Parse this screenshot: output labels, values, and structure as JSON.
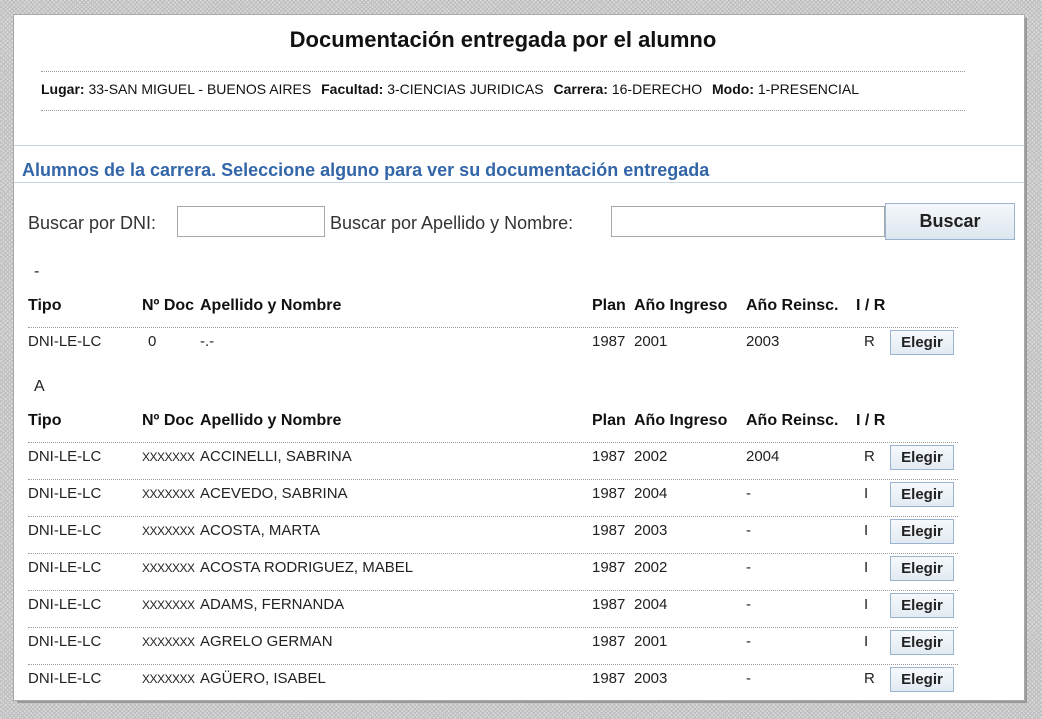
{
  "page": {
    "title": "Documentación entregada por el alumno"
  },
  "info": {
    "lugar_label": "Lugar:",
    "lugar": "33-SAN MIGUEL - BUENOS AIRES",
    "facultad_label": "Facultad:",
    "facultad": "3-CIENCIAS JURIDICAS",
    "carrera_label": "Carrera:",
    "carrera": "16-DERECHO",
    "modo_label": "Modo:",
    "modo": "1-PRESENCIAL"
  },
  "section": {
    "title": "Alumnos de la carrera. Seleccione alguno para ver su documentación entregada"
  },
  "search": {
    "dni_label": "Buscar por DNI:",
    "dni_value": "",
    "name_label": "Buscar por Apellido y Nombre:",
    "name_value": "",
    "button_label": "Buscar"
  },
  "table_header": {
    "tipo": "Tipo",
    "doc": "Nº Doc",
    "nombre": "Apellido y Nombre",
    "plan": "Plan",
    "anio_ingreso": "Año Ingreso",
    "anio_reinsc": "Año Reinsc.",
    "ir": "I / R"
  },
  "groups": [
    {
      "letter": "-",
      "rows": [
        {
          "tipo": "DNI-LE-LC",
          "doc": "0",
          "nombre": "-.-",
          "plan": "1987",
          "ingreso": "2001",
          "reinsc": "2003",
          "ir": "R",
          "action": "Elegir"
        }
      ]
    },
    {
      "letter": "A",
      "rows": [
        {
          "tipo": "DNI-LE-LC",
          "doc": "XXXXXXX",
          "nombre": "ACCINELLI, SABRINA",
          "plan": "1987",
          "ingreso": "2002",
          "reinsc": "2004",
          "ir": "R",
          "action": "Elegir"
        },
        {
          "tipo": "DNI-LE-LC",
          "doc": "XXXXXXX",
          "nombre": "ACEVEDO, SABRINA",
          "plan": "1987",
          "ingreso": "2004",
          "reinsc": "-",
          "ir": "I",
          "action": "Elegir"
        },
        {
          "tipo": "DNI-LE-LC",
          "doc": "XXXXXXX",
          "nombre": "ACOSTA, MARTA",
          "plan": "1987",
          "ingreso": "2003",
          "reinsc": "-",
          "ir": "I",
          "action": "Elegir"
        },
        {
          "tipo": "DNI-LE-LC",
          "doc": "XXXXXXX",
          "nombre": "ACOSTA RODRIGUEZ, MABEL",
          "plan": "1987",
          "ingreso": "2002",
          "reinsc": "-",
          "ir": "I",
          "action": "Elegir"
        },
        {
          "tipo": "DNI-LE-LC",
          "doc": "XXXXXXX",
          "nombre": "ADAMS, FERNANDA",
          "plan": "1987",
          "ingreso": "2004",
          "reinsc": "-",
          "ir": "I",
          "action": "Elegir"
        },
        {
          "tipo": "DNI-LE-LC",
          "doc": "XXXXXXX",
          "nombre": "AGRELO GERMAN",
          "plan": "1987",
          "ingreso": "2001",
          "reinsc": "-",
          "ir": "I",
          "action": "Elegir"
        },
        {
          "tipo": "DNI-LE-LC",
          "doc": "XXXXXXX",
          "nombre": "AGÜERO, ISABEL",
          "plan": "1987",
          "ingreso": "2003",
          "reinsc": "-",
          "ir": "R",
          "action": "Elegir"
        }
      ]
    }
  ]
}
